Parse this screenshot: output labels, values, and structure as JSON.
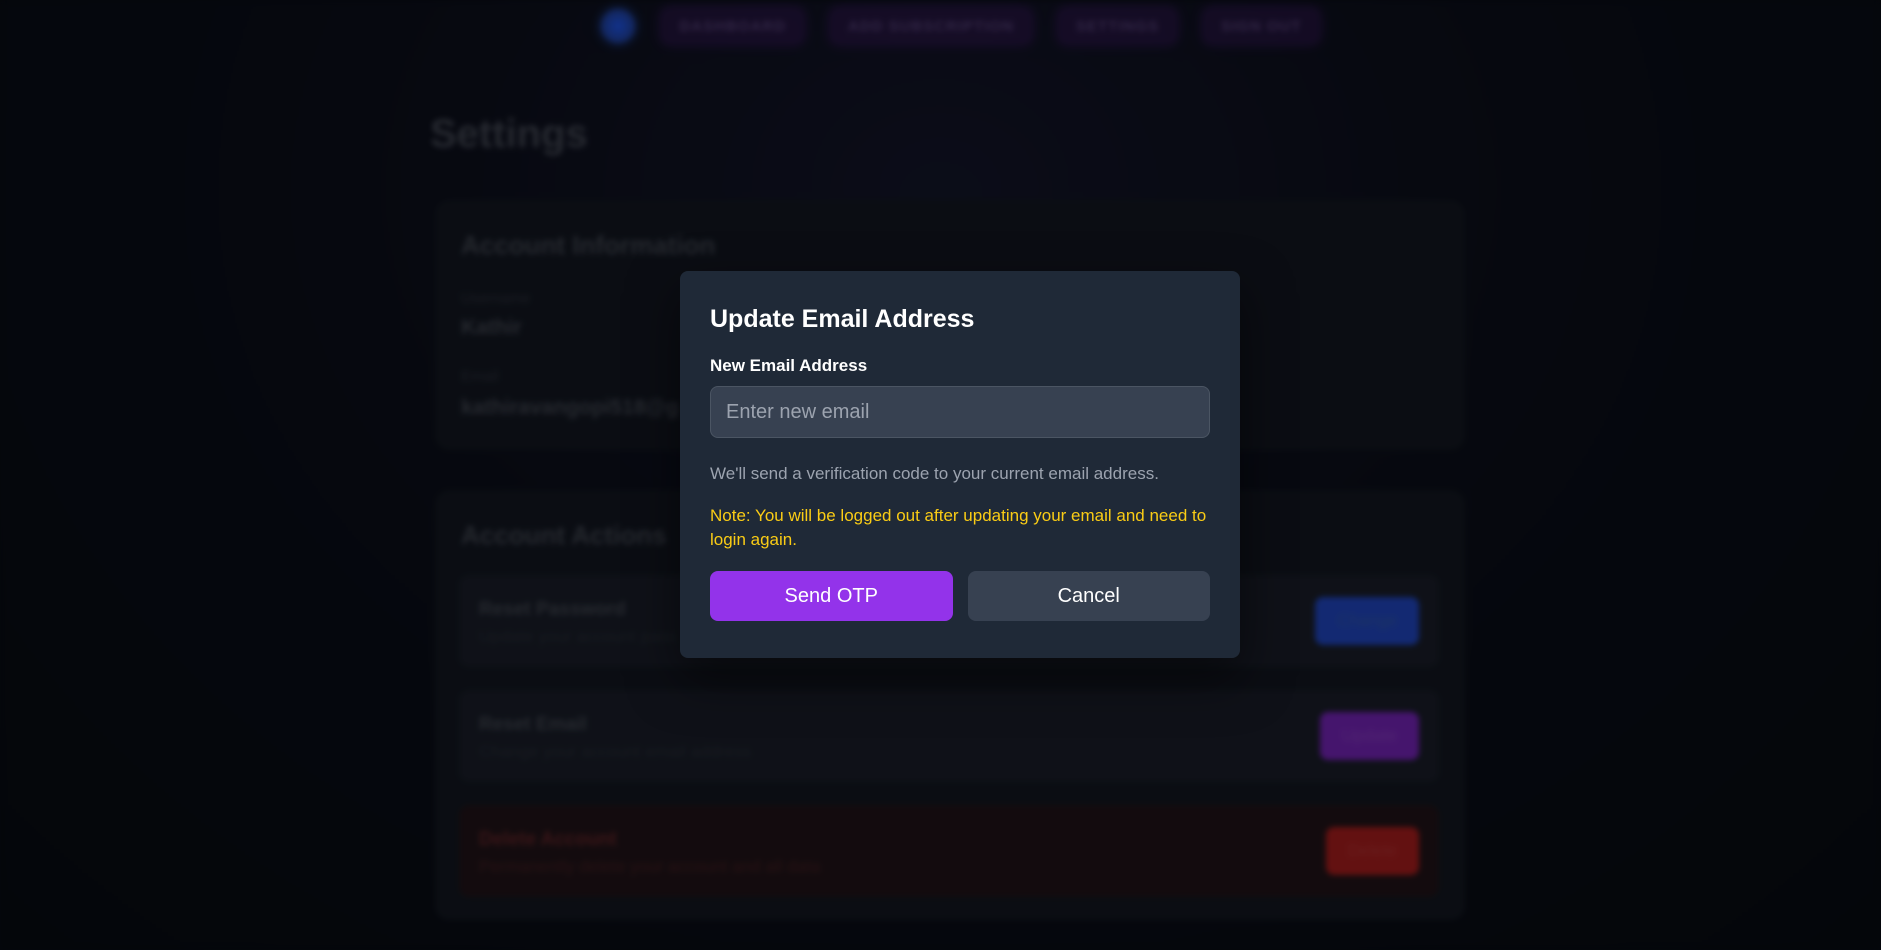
{
  "nav": {
    "items": [
      "DASHBOARD",
      "ADD SUBSCRIPTION",
      "SETTINGS",
      "SIGN OUT"
    ]
  },
  "page": {
    "title": "Settings"
  },
  "account_info": {
    "title": "Account Information",
    "username_label": "Username",
    "username_value": "Kathir",
    "email_label": "Email",
    "email_value": "kathiravangopi518@g"
  },
  "account_actions": {
    "title": "Account Actions",
    "rows": [
      {
        "title": "Reset Password",
        "desc": "Update your account pass",
        "button": "Change"
      },
      {
        "title": "Reset Email",
        "desc": "Change your account email address",
        "button": "Update"
      },
      {
        "title": "Delete Account",
        "desc": "Permanently delete your account and all data",
        "button": "Delete"
      }
    ]
  },
  "modal": {
    "title": "Update Email Address",
    "field_label": "New Email Address",
    "input_placeholder": "Enter new email",
    "input_value": "",
    "hint": "We'll send a verification code to your current email address.",
    "note": "Note: You will be logged out after updating your email and need to login again.",
    "primary_button": "Send OTP",
    "secondary_button": "Cancel"
  },
  "colors": {
    "modal_bg": "#1f2937",
    "primary": "#9333ea",
    "secondary": "#374151",
    "note": "#facc15"
  }
}
